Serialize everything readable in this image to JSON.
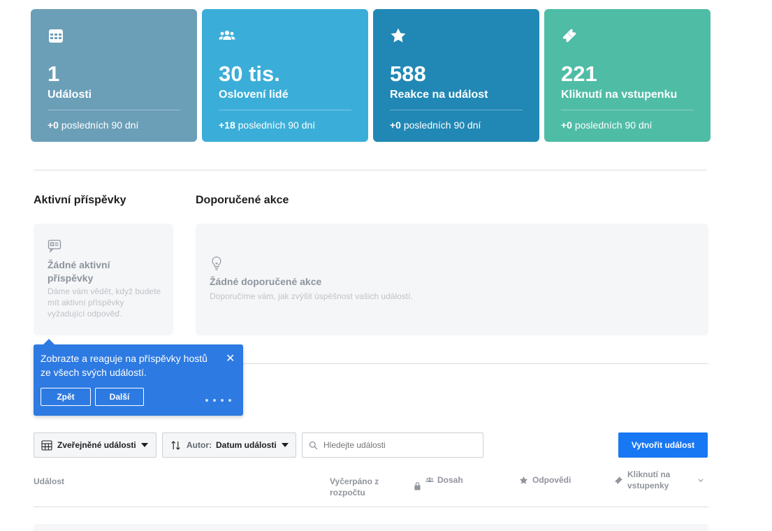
{
  "stats": [
    {
      "icon": "calendar-icon",
      "value": "1",
      "label": "Události",
      "delta": "+0",
      "period": "posledních 90 dní",
      "color": "#6b9fb8"
    },
    {
      "icon": "people-icon",
      "value": "30 tis.",
      "label": "Oslovení lidé",
      "delta": "+18",
      "period": "posledních 90 dní",
      "color": "#3aaed8"
    },
    {
      "icon": "star-icon",
      "value": "588",
      "label": "Reakce na událost",
      "delta": "+0",
      "period": "posledních 90 dní",
      "color": "#2188b5"
    },
    {
      "icon": "ticket-icon",
      "value": "221",
      "label": "Kliknutí na vstupenku",
      "delta": "+0",
      "period": "posledních 90 dní",
      "color": "#4fbca6"
    }
  ],
  "active_posts": {
    "title": "Aktivní příspěvky",
    "empty_title": "Žádné aktivní příspěvky",
    "empty_text": "Dáme vám vědět, když budete mít aktivní příspěvky vyžadující odpověď."
  },
  "recommended": {
    "title": "Doporučené akce",
    "empty_title": "Žádné doporučené akce",
    "empty_text": "Doporučíme vám, jak zvýšit úspěšnost vašich událostí."
  },
  "tooltip": {
    "message": "Zobrazte a reaguje na příspěvky hostů ze všech svých událostí.",
    "back": "Zpět",
    "next": "Další"
  },
  "toolbar": {
    "filter": "Zveřejněné události",
    "sort_prefix": "Autor:",
    "sort_value": "Datum události",
    "search_placeholder": "Hledejte události",
    "create": "Vytvořit událost"
  },
  "table": {
    "col_event": "Událost",
    "col_budget": "Vyčerpáno z rozpočtu",
    "col_reach": "Dosah",
    "col_responses": "Odpovědi",
    "col_ticket": "Kliknutí na vstupenky"
  },
  "colors": {
    "accent": "#1877f2",
    "tooltip": "#2d7ae2"
  }
}
